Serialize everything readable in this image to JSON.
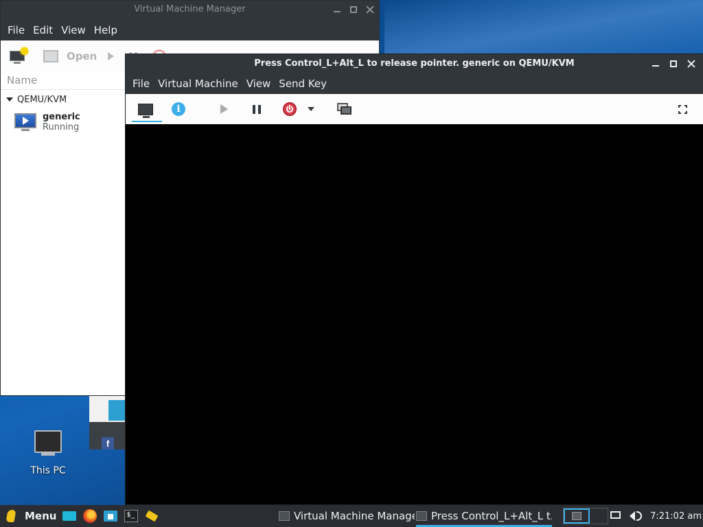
{
  "desktop": {
    "icon_label": "This PC"
  },
  "vmm": {
    "title": "Virtual Machine Manager",
    "menu": [
      "File",
      "Edit",
      "View",
      "Help"
    ],
    "toolbar": {
      "open_label": "Open"
    },
    "column_header": "Name",
    "connection": "QEMU/KVM",
    "vm": {
      "name": "generic",
      "state": "Running"
    }
  },
  "console": {
    "title": "Press Control_L+Alt_L to release pointer. generic on QEMU/KVM",
    "menu": [
      "File",
      "Virtual Machine",
      "View",
      "Send Key"
    ]
  },
  "taskbar": {
    "menu_label": "Menu",
    "tasks": [
      "Virtual Machine Manager",
      "Press Control_L+Alt_L t..."
    ],
    "clock": "7:21:02 am"
  },
  "colors": {
    "accent": "#3daee9",
    "titlebar": "#31363b",
    "taskbar": "#2a2e32"
  },
  "icons": {
    "launchers": [
      "show-desktop-icon",
      "firefox-icon",
      "home-folder-icon",
      "terminal-icon",
      "text-editor-icon"
    ],
    "tray": [
      "display-icon",
      "volume-icon"
    ]
  }
}
